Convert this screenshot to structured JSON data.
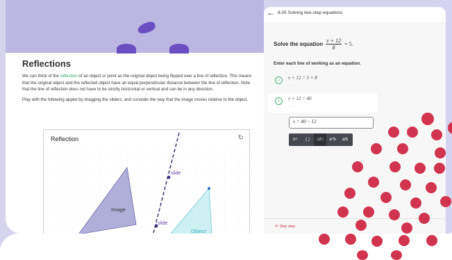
{
  "lesson": {
    "title": "Reflections",
    "para1_pre": "We can think of the ",
    "para1_link": "reflection",
    "para1_post": " of an object or point as the original object being flipped over a line of reflection. This means that the original object and the reflected object have an equal perpendicular distance between the line of reflection. Note that the line of reflection does not have to be strictly horizontal or vertical and can be in any direction.",
    "para2": "Play with the following applet by dragging the sliders, and consider the way that the image moves relative to the object."
  },
  "applet": {
    "title": "Reflection",
    "refresh_icon": "refresh-icon",
    "slide_label_1": "slide",
    "slide_label_2": "slide",
    "image_label": "Image",
    "object_label": "Object"
  },
  "panel": {
    "back_icon": "back-arrow-icon",
    "header_title": "8.05 Solving two-step equations",
    "solve_prefix": "Solve the equation",
    "fraction_num": "v + 12",
    "fraction_den": "8",
    "equation_rhs": "= 5.",
    "instruction": "Enter each line of working as an equation.",
    "steps": [
      {
        "math": "v + 12 = 5 × 8",
        "dots": "..."
      },
      {
        "math": "v + 12 = 40",
        "dots": "..."
      }
    ],
    "input_value": "v = 40 − 12",
    "toolbar": [
      "±÷",
      "( )",
      "□/□",
      "a^b",
      "a/b"
    ],
    "skip_label": "Skip step"
  },
  "colors": {
    "accent_red": "#d1344f",
    "lavender": "#d6d3ee",
    "link_green": "#3aa86b",
    "check_green": "#49b36f"
  }
}
